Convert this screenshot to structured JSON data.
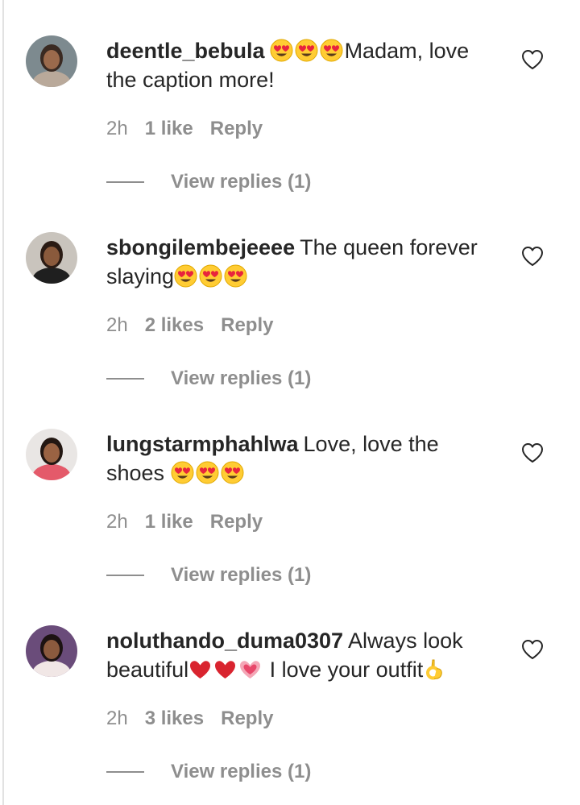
{
  "comments": [
    {
      "username": "deentle_bebula",
      "avatar": "profile-photo",
      "body": [
        {
          "type": "emoji",
          "name": "heart-eyes-emoji",
          "symbol": "😍"
        },
        {
          "type": "emoji",
          "name": "heart-eyes-emoji",
          "symbol": "😍"
        },
        {
          "type": "emoji",
          "name": "heart-eyes-emoji",
          "symbol": "😍"
        },
        {
          "type": "text",
          "text": "Madam, love the caption more!"
        }
      ],
      "time": "2h",
      "likes": "1 like",
      "reply_label": "Reply",
      "view_replies": "View replies (1)",
      "like_icon": "heart-outline-icon"
    },
    {
      "username": "sbongilembejeeee",
      "avatar": "profile-photo",
      "body": [
        {
          "type": "text",
          "text": "The queen forever slaying"
        },
        {
          "type": "emoji",
          "name": "heart-eyes-emoji",
          "symbol": "😍"
        },
        {
          "type": "emoji",
          "name": "heart-eyes-emoji",
          "symbol": "😍"
        },
        {
          "type": "emoji",
          "name": "heart-eyes-emoji",
          "symbol": "😍"
        }
      ],
      "time": "2h",
      "likes": "2 likes",
      "reply_label": "Reply",
      "view_replies": "View replies (1)",
      "like_icon": "heart-outline-icon"
    },
    {
      "username": "lungstarmphahlwa",
      "avatar": "profile-photo",
      "body": [
        {
          "type": "text",
          "text": "Love, love the shoes "
        },
        {
          "type": "emoji",
          "name": "heart-eyes-emoji",
          "symbol": "😍"
        },
        {
          "type": "emoji",
          "name": "heart-eyes-emoji",
          "symbol": "😍"
        },
        {
          "type": "emoji",
          "name": "heart-eyes-emoji",
          "symbol": "😍"
        }
      ],
      "time": "2h",
      "likes": "1 like",
      "reply_label": "Reply",
      "view_replies": "View replies (1)",
      "like_icon": "heart-outline-icon"
    },
    {
      "username": "noluthando_duma0307",
      "avatar": "profile-photo",
      "body": [
        {
          "type": "text",
          "text": "Always look beautiful"
        },
        {
          "type": "emoji",
          "name": "red-heart-emoji",
          "symbol": "❤️"
        },
        {
          "type": "emoji",
          "name": "red-heart-emoji",
          "symbol": "❤️"
        },
        {
          "type": "emoji",
          "name": "growing-heart-emoji",
          "symbol": "💗"
        },
        {
          "type": "text",
          "text": " I love your outfit"
        },
        {
          "type": "emoji",
          "name": "ok-hand-emoji",
          "symbol": "👌"
        }
      ],
      "time": "2h",
      "likes": "3 likes",
      "reply_label": "Reply",
      "view_replies": "View replies (1)",
      "like_icon": "heart-outline-icon"
    }
  ],
  "colors": {
    "text": "#262626",
    "secondary": "#8e8e8e",
    "background": "#ffffff",
    "emoji_yellow": "#ffcc33",
    "emoji_heart": "#e8243d",
    "heart_red": "#d9242f"
  }
}
